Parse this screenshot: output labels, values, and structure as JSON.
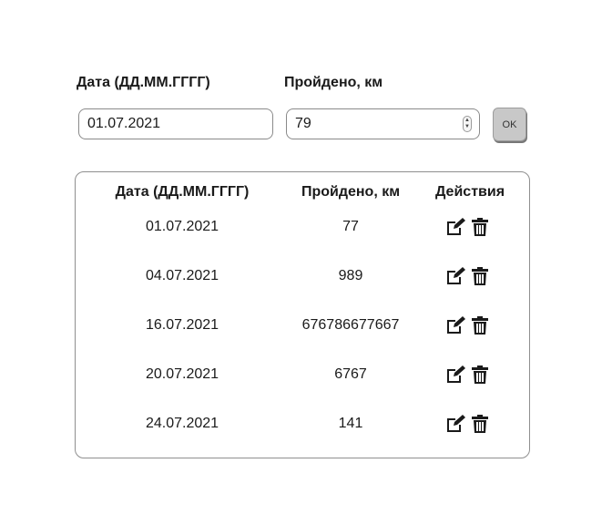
{
  "form": {
    "date_label": "Дата (ДД.ММ.ГГГГ)",
    "distance_label": "Пройдено, км",
    "date_value": "01.07.2021",
    "distance_value": "79",
    "ok_label": "OK"
  },
  "table": {
    "headers": {
      "date": "Дата (ДД.ММ.ГГГГ)",
      "distance": "Пройдено, км",
      "actions": "Действия"
    },
    "rows": [
      {
        "date": "01.07.2021",
        "distance": "77"
      },
      {
        "date": "04.07.2021",
        "distance": "989"
      },
      {
        "date": "16.07.2021",
        "distance": "676786677667"
      },
      {
        "date": "20.07.2021",
        "distance": "6767"
      },
      {
        "date": "24.07.2021",
        "distance": "141"
      }
    ]
  },
  "icons": {
    "edit": "edit-icon",
    "delete": "trash-icon"
  }
}
